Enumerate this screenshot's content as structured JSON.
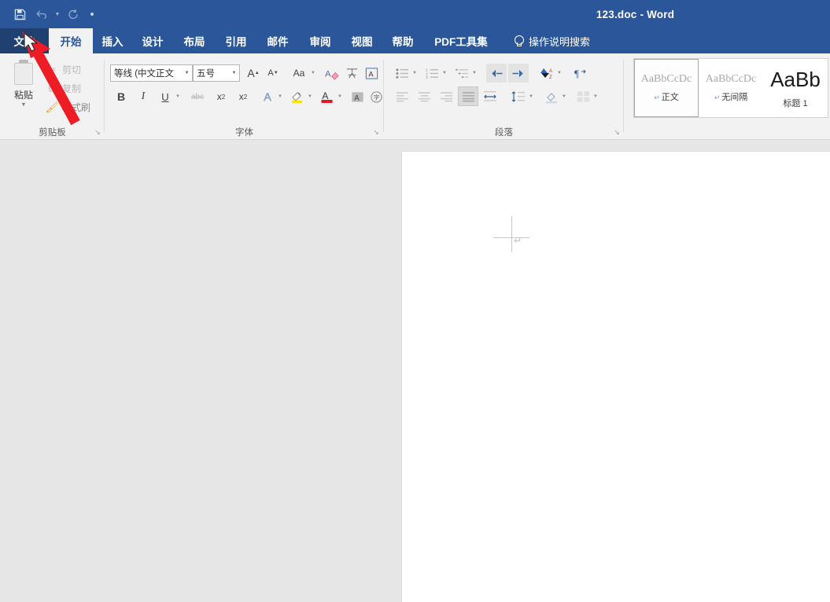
{
  "window": {
    "title": "123.doc  -  Word",
    "accent_color": "#2b579a",
    "file_tab_color": "#204072",
    "ribbon_bg": "#f2f2f2",
    "doc_bg": "#e6e6e6"
  },
  "quick_access": [
    {
      "name": "save-button",
      "icon": "save-icon",
      "label": "保存"
    },
    {
      "name": "undo-button",
      "icon": "undo-icon",
      "label": "撤消"
    },
    {
      "name": "redo-button",
      "icon": "redo-icon",
      "label": "重复"
    },
    {
      "name": "customize-qat-button",
      "icon": "dot-icon",
      "label": "自定义快速访问工具栏"
    }
  ],
  "tabs": [
    {
      "label": "文件",
      "state": "file"
    },
    {
      "label": "开始",
      "state": "active"
    },
    {
      "label": "插入",
      "state": "normal"
    },
    {
      "label": "设计",
      "state": "normal"
    },
    {
      "label": "布局",
      "state": "normal"
    },
    {
      "label": "引用",
      "state": "normal"
    },
    {
      "label": "邮件",
      "state": "normal"
    },
    {
      "label": "审阅",
      "state": "normal"
    },
    {
      "label": "视图",
      "state": "normal"
    },
    {
      "label": "帮助",
      "state": "normal"
    },
    {
      "label": "PDF工具集",
      "state": "normal"
    }
  ],
  "search": {
    "label": "操作说明搜索",
    "icon": "lightbulb-icon"
  },
  "groups": {
    "clipboard": {
      "label": "剪贴板",
      "paste": {
        "label": "粘贴",
        "icon": "clipboard-icon"
      },
      "cut": {
        "label": "剪切",
        "icon": "scissors-icon"
      },
      "copy": {
        "label": "复制",
        "icon": "copy-icon"
      },
      "format_painter": {
        "label": "格式刷",
        "icon": "paintbrush-icon"
      },
      "launcher": "↘"
    },
    "font": {
      "label": "字体",
      "font_name": "等线 (中文正文",
      "font_size": "五号",
      "buttons": [
        {
          "name": "grow-font-button",
          "glyph": "A",
          "sup": "▲"
        },
        {
          "name": "shrink-font-button",
          "glyph": "A",
          "sup": "▼"
        },
        {
          "name": "change-case-button",
          "glyph": "Aa"
        },
        {
          "name": "clear-formatting-button",
          "glyph": "A"
        },
        {
          "name": "phonetic-guide-button",
          "glyph": "文"
        },
        {
          "name": "character-border-button",
          "glyph": "A"
        },
        {
          "name": "bold-button",
          "glyph": "B"
        },
        {
          "name": "italic-button",
          "glyph": "I"
        },
        {
          "name": "underline-button",
          "glyph": "U"
        },
        {
          "name": "strikethrough-button",
          "glyph": "abc"
        },
        {
          "name": "subscript-button",
          "glyph": "x₂"
        },
        {
          "name": "superscript-button",
          "glyph": "x²"
        },
        {
          "name": "text-effects-button",
          "glyph": "A"
        },
        {
          "name": "text-highlight-button",
          "glyph": "ab"
        },
        {
          "name": "font-color-button",
          "glyph": "A"
        },
        {
          "name": "character-shading-button",
          "glyph": "A"
        },
        {
          "name": "enclose-characters-button",
          "glyph": "字"
        }
      ],
      "launcher": "↘"
    },
    "paragraph": {
      "label": "段落",
      "buttons": [
        {
          "name": "bullets-button"
        },
        {
          "name": "numbering-button"
        },
        {
          "name": "multilevel-list-button"
        },
        {
          "name": "decrease-indent-button"
        },
        {
          "name": "increase-indent-button"
        },
        {
          "name": "sort-button"
        },
        {
          "name": "show-formatting-marks-button"
        },
        {
          "name": "align-left-button"
        },
        {
          "name": "align-center-button"
        },
        {
          "name": "align-right-button"
        },
        {
          "name": "justify-button"
        },
        {
          "name": "distribute-button"
        },
        {
          "name": "line-spacing-button"
        },
        {
          "name": "shading-button"
        },
        {
          "name": "borders-button"
        }
      ],
      "launcher": "↘"
    },
    "styles": {
      "items": [
        {
          "preview": "AaBbCcDc",
          "name": "正文",
          "selected": true,
          "pilcrow": true
        },
        {
          "preview": "AaBbCcDc",
          "name": "无间隔",
          "selected": false,
          "pilcrow": true
        },
        {
          "preview": "AaBb",
          "name": "标题 1",
          "selected": false,
          "pilcrow": false,
          "heading": true
        }
      ]
    }
  },
  "document": {
    "cursor": "text-cursor-crosshair",
    "paragraph_mark": "↵"
  },
  "annotation": {
    "arrow_color": "#ee1c25",
    "points_to": "文件",
    "mouse_cursor": "arrow-pointer"
  }
}
